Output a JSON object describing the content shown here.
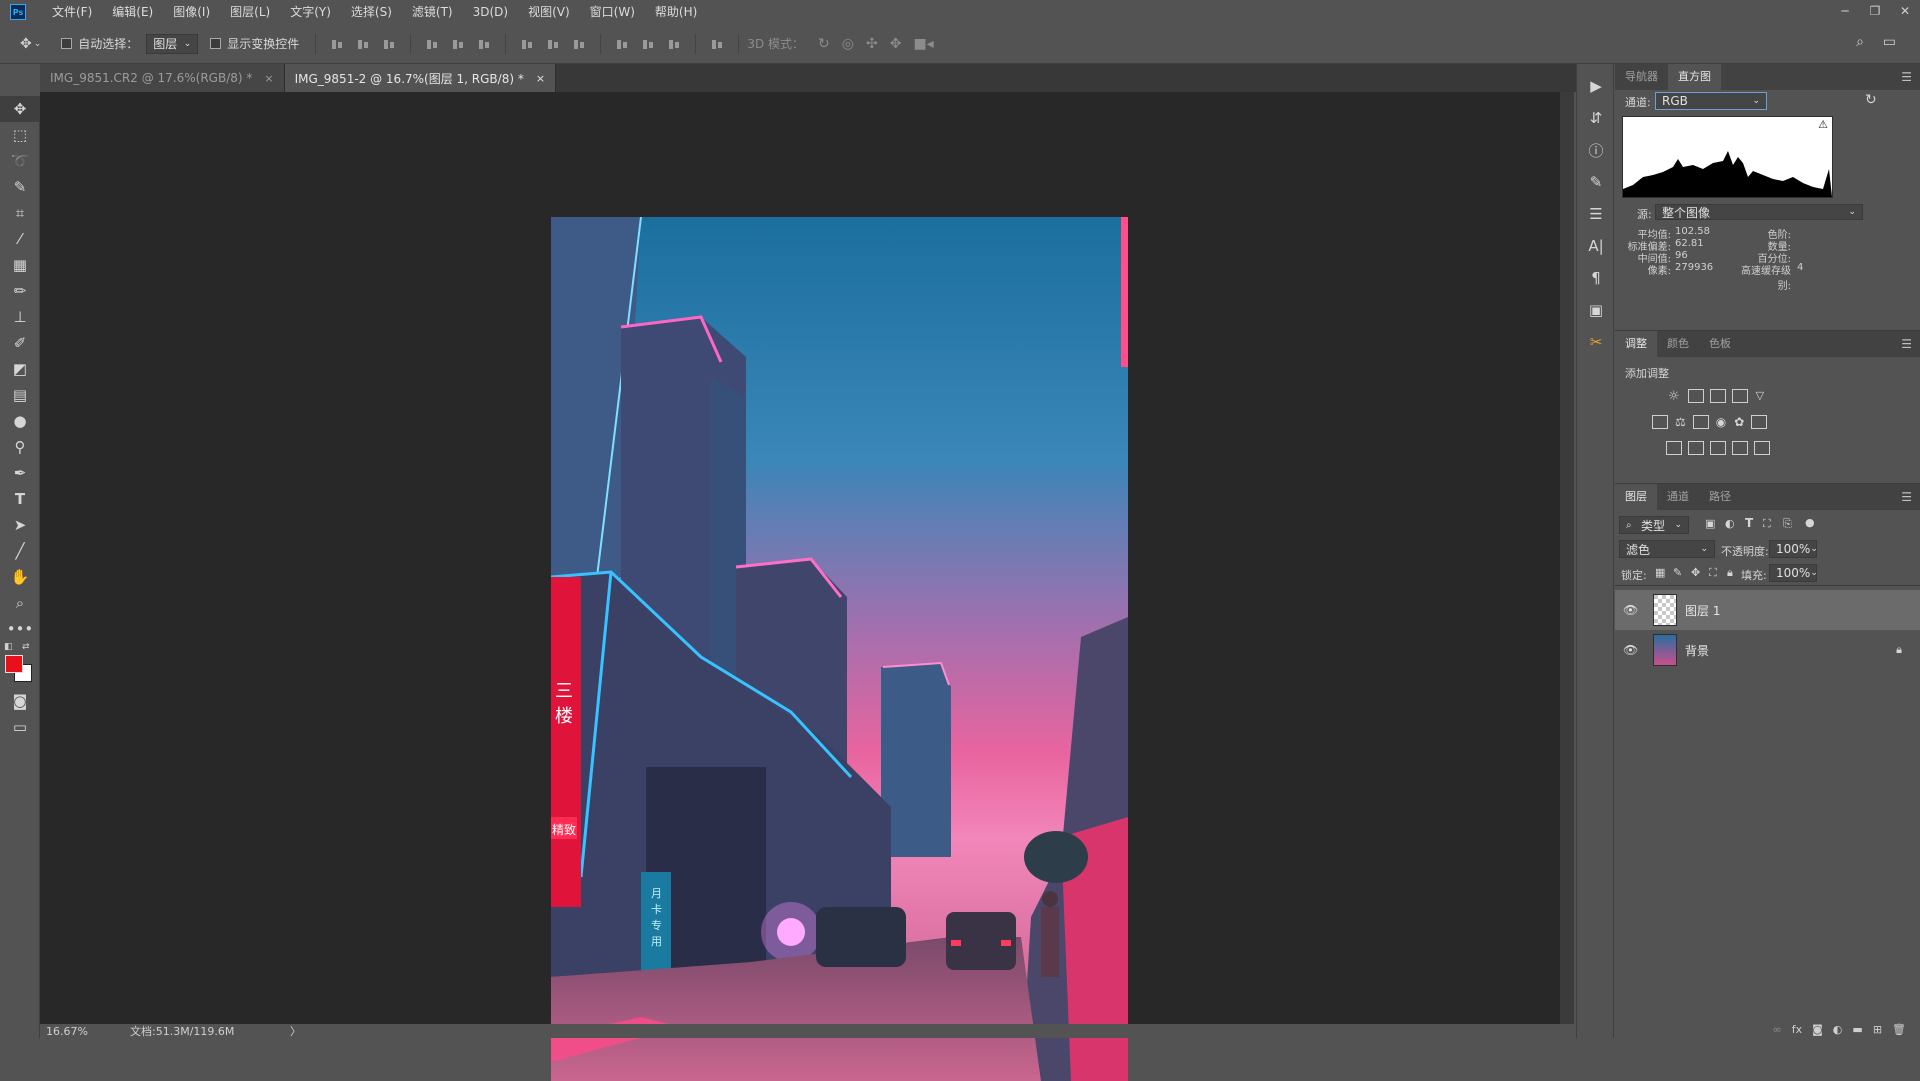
{
  "app": {
    "logo": "Ps"
  },
  "menu": [
    "文件(F)",
    "编辑(E)",
    "图像(I)",
    "图层(L)",
    "文字(Y)",
    "选择(S)",
    "滤镜(T)",
    "3D(D)",
    "视图(V)",
    "窗口(W)",
    "帮助(H)"
  ],
  "options": {
    "auto_select_label": "自动选择：",
    "auto_select_value": "图层",
    "show_transform_label": "显示变换控件",
    "mode_3d_label": "3D 模式："
  },
  "tabs": [
    {
      "label": "IMG_9851.CR2 @ 17.6%(RGB/8) *",
      "close": "×"
    },
    {
      "label": "IMG_9851-2 @ 16.7%(图层 1, RGB/8) *",
      "close": "×"
    }
  ],
  "status": {
    "zoom": "16.67%",
    "doc": "文档:51.3M/119.6M",
    "arrow": "〉"
  },
  "histogram": {
    "tabs": [
      "导航器",
      "直方图"
    ],
    "channel_label": "通道:",
    "channel_value": "RGB",
    "source_label": "源:",
    "source_value": "整个图像",
    "stats_left": [
      {
        "label": "平均值:",
        "value": "102.58"
      },
      {
        "label": "标准偏差:",
        "value": "62.81"
      },
      {
        "label": "中间值:",
        "value": "96"
      },
      {
        "label": "像素:",
        "value": "279936"
      }
    ],
    "stats_right": [
      {
        "label": "色阶:",
        "value": ""
      },
      {
        "label": "数量:",
        "value": ""
      },
      {
        "label": "百分位:",
        "value": ""
      },
      {
        "label": "高速缓存级别:",
        "value": "4"
      }
    ]
  },
  "adjustments": {
    "tabs": [
      "调整",
      "颜色",
      "色板"
    ],
    "title": "添加调整"
  },
  "layers": {
    "tabs": [
      "图层",
      "通道",
      "路径"
    ],
    "filter_label": "类型",
    "blend_mode": "滤色",
    "opacity_label": "不透明度:",
    "opacity_value": "100%",
    "lock_label": "锁定:",
    "fill_label": "填充:",
    "fill_value": "100%",
    "items": [
      {
        "name": "图层 1",
        "selected": true
      },
      {
        "name": "背景",
        "selected": false
      }
    ],
    "footer_fx": "fx"
  },
  "colors": {
    "foreground": "#e8101a",
    "background": "#ffffff"
  }
}
